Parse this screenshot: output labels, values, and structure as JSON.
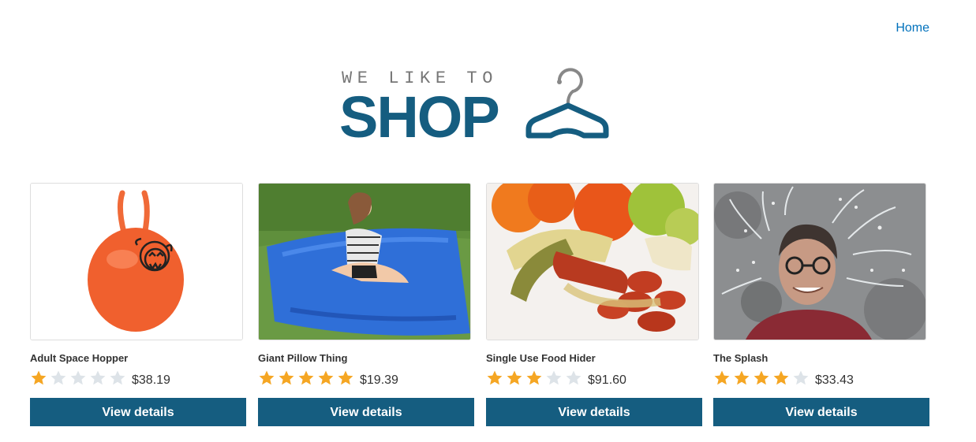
{
  "nav": {
    "home": "Home"
  },
  "logo": {
    "tagline": "WE LIKE TO",
    "word": "SHOP"
  },
  "colors": {
    "brand": "#155d80",
    "link": "#0071bc",
    "star_on": "#f5a623",
    "star_off": "#dde3e8"
  },
  "products": [
    {
      "name": "Adult Space Hopper",
      "rating": 1,
      "price": "$38.19",
      "button": "View details",
      "image": "space-hopper-image"
    },
    {
      "name": "Giant Pillow Thing",
      "rating": 5,
      "price": "$19.39",
      "button": "View details",
      "image": "pillow-image"
    },
    {
      "name": "Single Use Food Hider",
      "rating": 3,
      "price": "$91.60",
      "button": "View details",
      "image": "food-image"
    },
    {
      "name": "The Splash",
      "rating": 4,
      "price": "$33.43",
      "button": "View details",
      "image": "splash-image"
    }
  ]
}
